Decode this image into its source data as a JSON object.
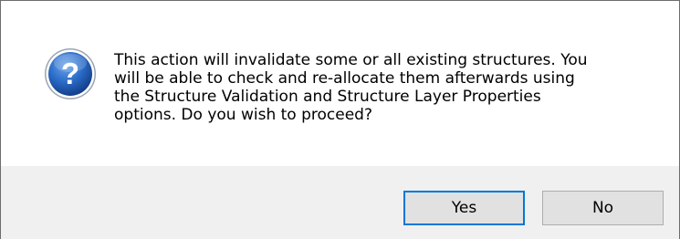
{
  "dialog": {
    "icon": "question-icon",
    "icon_glyph": "?",
    "message": "This action will invalidate some or all existing structures. You\nwill be able to check and re-allocate them afterwards using\nthe Structure Validation and Structure Layer Properties\noptions.  Do you wish to proceed?",
    "buttons": {
      "yes": "Yes",
      "no": "No"
    }
  },
  "colors": {
    "icon_blue": "#1e5eb5",
    "content_bg": "#ffffff",
    "footer_bg": "#f0f0f0",
    "button_bg": "#e1e1e1",
    "default_button_border": "#0078d7"
  }
}
